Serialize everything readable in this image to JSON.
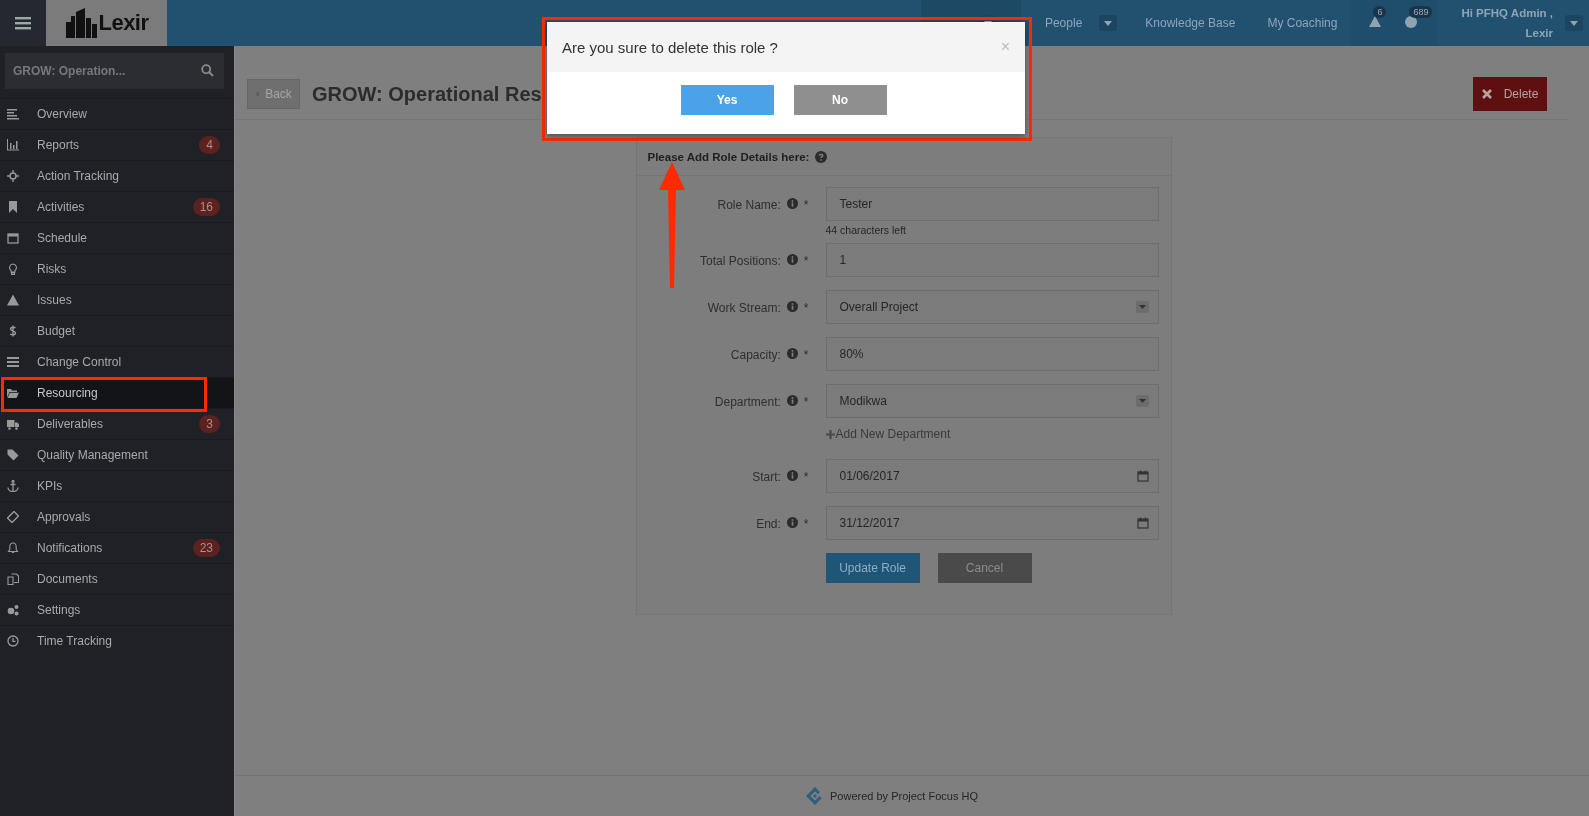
{
  "topbar": {
    "logo": "Lexir",
    "nav": [
      {
        "label": "People",
        "dropdown": true
      },
      {
        "label": "Knowledge Base",
        "dropdown": false
      },
      {
        "label": "My Coaching",
        "dropdown": false
      }
    ],
    "alerts_count": "6",
    "tasks_count": "689",
    "user_greeting": "Hi PFHQ Admin ,",
    "user_org": "Lexir"
  },
  "sidebar": {
    "search": {
      "value": "GROW: Operation..."
    },
    "items": [
      {
        "label": "Overview",
        "selected": false
      },
      {
        "label": "Reports",
        "badge": "4",
        "selected": false
      },
      {
        "label": "Action Tracking",
        "selected": false
      },
      {
        "label": "Activities",
        "badge": "16",
        "selected": false
      },
      {
        "label": "Schedule",
        "selected": false
      },
      {
        "label": "Risks",
        "selected": false
      },
      {
        "label": "Issues",
        "selected": false
      },
      {
        "label": "Budget",
        "selected": false
      },
      {
        "label": "Change Control",
        "selected": false
      },
      {
        "label": "Resourcing",
        "selected": true
      },
      {
        "label": "Deliverables",
        "badge": "3",
        "selected": false
      },
      {
        "label": "Quality Management",
        "selected": false
      },
      {
        "label": "KPIs",
        "selected": false
      },
      {
        "label": "Approvals",
        "selected": false
      },
      {
        "label": "Notifications",
        "badge": "23",
        "selected": false
      },
      {
        "label": "Documents",
        "selected": false
      },
      {
        "label": "Settings",
        "selected": false
      },
      {
        "label": "Time Tracking",
        "selected": false
      }
    ]
  },
  "page": {
    "back": "Back",
    "title": "GROW: Operational Res",
    "delete": "Delete"
  },
  "form": {
    "heading": "Please Add Role Details here:",
    "fields": [
      {
        "label": "Role Name:",
        "kind": "text",
        "value": "Tester",
        "hint": "44 characters left"
      },
      {
        "label": "Total Positions:",
        "kind": "text",
        "value": "1"
      },
      {
        "label": "Work Stream:",
        "kind": "select",
        "value": "Overall Project"
      },
      {
        "label": "Capacity:",
        "kind": "text",
        "value": "80%"
      },
      {
        "label": "Department:",
        "kind": "select",
        "value": "Modikwa",
        "link": "Add New Department"
      },
      {
        "label": "Start:",
        "kind": "date",
        "value": "01/06/2017"
      },
      {
        "label": "End:",
        "kind": "date",
        "value": "31/12/2017"
      }
    ],
    "required_mark": "*",
    "buttons": [
      {
        "label": "Update Role",
        "kind": "primary"
      },
      {
        "label": "Cancel",
        "kind": "secondary"
      }
    ]
  },
  "dialog": {
    "title": "Are you sure to delete this role ?",
    "close": "×",
    "buttons": [
      {
        "label": "Yes",
        "kind": "primary"
      },
      {
        "label": "No",
        "kind": "secondary"
      }
    ]
  },
  "footer": {
    "text": "Powered by Project Focus HQ"
  }
}
